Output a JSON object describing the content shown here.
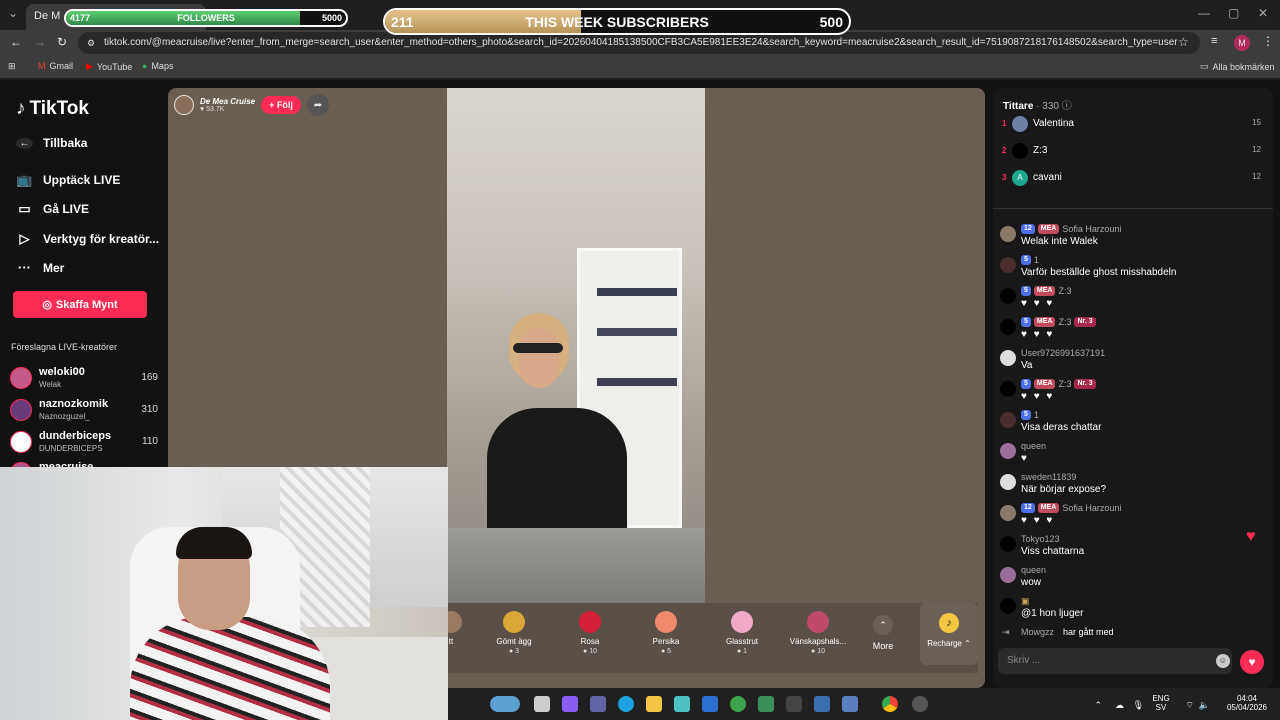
{
  "browser": {
    "tab_title": "De M",
    "url": "tiktok.com/@meacruise/live?enter_from_merge=search_user&enter_method=others_photo&search_id=20260404185138500CFB3CA5E981EE3E24&search_keyword=meacruise2&search_result_id=7519087218176148502&search_type=user",
    "bookmarks": [
      "Gmail",
      "YouTube",
      "Maps"
    ],
    "all_bookmarks": "Alla bokmärken",
    "profile_initial": "M"
  },
  "overlay": {
    "followers": {
      "current": "4177",
      "label": "FOLLOWERS",
      "goal": "5000",
      "progress": 0.835
    },
    "subscribers": {
      "current": "211",
      "label": "THIS WEEK SUBSCRIBERS",
      "goal": "500",
      "progress": 0.422
    }
  },
  "sidebar": {
    "logo": "TikTok",
    "back": "Tillbaka",
    "nav": [
      {
        "label": "Upptäck LIVE",
        "icon": "tv-icon"
      },
      {
        "label": "Gå LIVE",
        "icon": "camera-icon"
      },
      {
        "label": "Verktyg för kreatör...",
        "icon": "creator-tools-icon"
      },
      {
        "label": "Mer",
        "icon": "more-icon"
      }
    ],
    "coins_button": "Skaffa Mynt",
    "suggested_title": "Föreslagna LIVE-kreatörer",
    "creators": [
      {
        "name": "weloki00",
        "sub": "Welak",
        "count": "169"
      },
      {
        "name": "naznozkomik",
        "sub": "Naznozguzel_",
        "count": "310"
      },
      {
        "name": "dunderbiceps",
        "sub": "DUNDERBICEPS",
        "count": "110"
      },
      {
        "name": "meacruise",
        "sub": "",
        "count": ""
      }
    ]
  },
  "stream": {
    "host_name": "De Mea Cruise",
    "host_likes": "53.7K",
    "follow_label": "+ Följ",
    "gifts": [
      {
        "name": "tt",
        "price": "",
        "color": "#9a7a64"
      },
      {
        "name": "Gömt ägg",
        "price": "3",
        "color": "#d9a637"
      },
      {
        "name": "Rosa",
        "price": "10",
        "color": "#d4203b"
      },
      {
        "name": "Persika",
        "price": "5",
        "color": "#f08a6a"
      },
      {
        "name": "Glasstrut",
        "price": "1",
        "color": "#f2a8c7"
      },
      {
        "name": "Vänskapshals...",
        "price": "10",
        "color": "#c14a6a"
      }
    ],
    "more_label": "More",
    "recharge_label": "Recharge"
  },
  "chat": {
    "viewers_label": "Tittare",
    "viewers_count": "330",
    "top_viewers": [
      {
        "rank": "1",
        "name": "Valentina",
        "score": "15"
      },
      {
        "rank": "2",
        "name": "Z:3",
        "score": "12"
      },
      {
        "rank": "3",
        "name": "cavani",
        "score": "12"
      }
    ],
    "messages": [
      {
        "user": "Sofia Harzouni",
        "level": "12",
        "fan": "MEA",
        "nr": "",
        "text": "Welak inte Walek"
      },
      {
        "user": "1",
        "level": "5",
        "fan": "",
        "nr": "",
        "text": "Varför beställde ghost misshabdeln"
      },
      {
        "user": "Z:3",
        "level": "5",
        "fan": "MEA",
        "nr": "",
        "text": "♥ ♥ ♥"
      },
      {
        "user": "Z:3",
        "level": "5",
        "fan": "MEA",
        "nr": "Nr. 3",
        "text": "♥ ♥ ♥"
      },
      {
        "user": "User9726991637191",
        "level": "",
        "fan": "",
        "nr": "",
        "text": "Va"
      },
      {
        "user": "Z:3",
        "level": "5",
        "fan": "MEA",
        "nr": "Nr. 3",
        "text": "♥ ♥ ♥"
      },
      {
        "user": "1",
        "level": "5",
        "fan": "",
        "nr": "",
        "text": "Visa deras chattar"
      },
      {
        "user": "queen",
        "level": "",
        "fan": "",
        "nr": "",
        "text": "♥"
      },
      {
        "user": "sweden11839",
        "level": "",
        "fan": "",
        "nr": "",
        "text": "När börjar expose?"
      },
      {
        "user": "Sofia Harzouni",
        "level": "12",
        "fan": "MEA",
        "nr": "",
        "text": "♥ ♥ ♥"
      },
      {
        "user": "Tokyo123",
        "level": "",
        "fan": "",
        "nr": "",
        "text": "Viss chattarna"
      },
      {
        "user": "queen",
        "level": "",
        "fan": "",
        "nr": "",
        "text": "wow"
      },
      {
        "user": "",
        "level": "",
        "fan": "",
        "nr": "",
        "text": "@1 hon ljuger"
      }
    ],
    "last_line_user": "Mowgzz",
    "last_line_text": "har gått med",
    "input_placeholder": "Skriv ..."
  },
  "taskbar": {
    "lang": "ENG",
    "lang2": "SV",
    "time": "04:04",
    "date": "05/04/2026"
  }
}
